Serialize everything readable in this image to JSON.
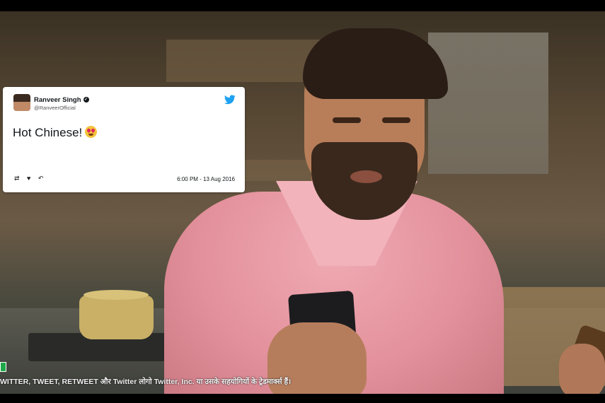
{
  "tweet": {
    "name": "Ranveer Singh",
    "handle": "@RanveerOfficial",
    "text": "Hot Chinese!",
    "emoji": "heart-eyes-emoji",
    "actions": "⇄ ♥ ↶",
    "timestamp": "6:00 PM - 13 Aug 2016"
  },
  "disclaimer": "WITTER, TWEET, RETWEET और Twitter लोगो Twitter, Inc. या उसके सहयोगियों के ट्रेडमार्क्स हैं।",
  "colors": {
    "twitter_blue": "#1da1f2",
    "shirt_pink": "#e3919c",
    "letterbox": "#000000"
  }
}
